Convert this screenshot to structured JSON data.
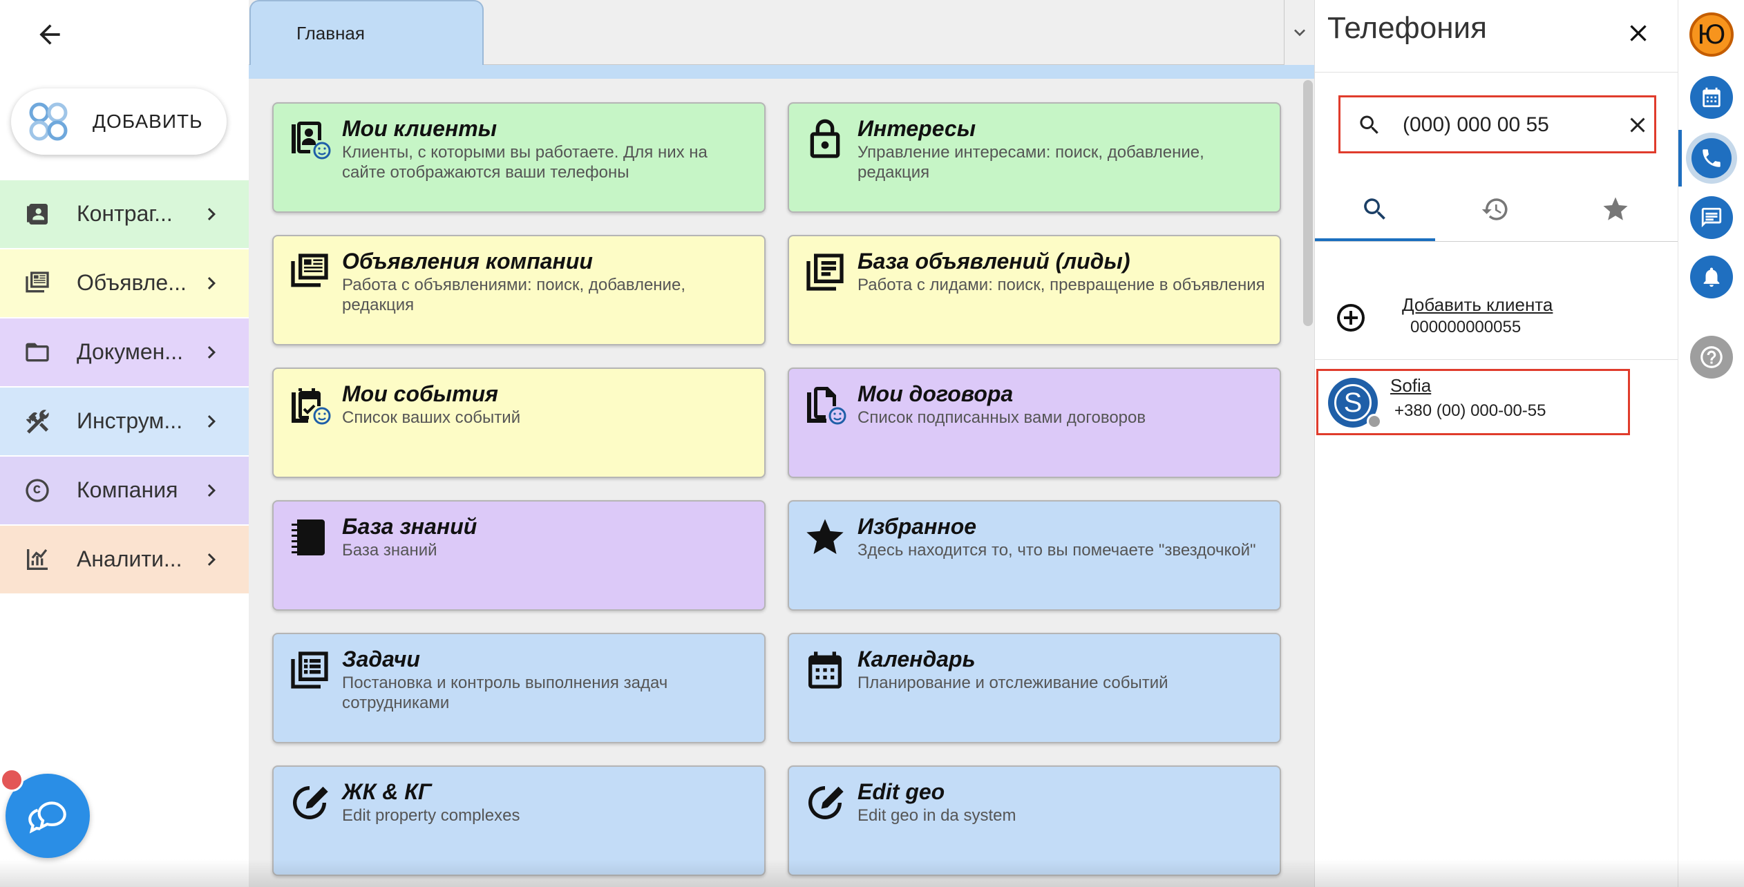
{
  "sidebar": {
    "add_label": "ДОБАВИТЬ",
    "items": [
      {
        "label": "Контраг...",
        "icon": "contacts-icon",
        "bg": "#d9f7d9"
      },
      {
        "label": "Объявле...",
        "icon": "listing-icon",
        "bg": "#fdfdd0"
      },
      {
        "label": "Докумен...",
        "icon": "folder-icon",
        "bg": "#e3d4fa"
      },
      {
        "label": "Инструм...",
        "icon": "tools-icon",
        "bg": "#d3e6fa"
      },
      {
        "label": "Компания",
        "icon": "copyright-icon",
        "bg": "#ddd3f8"
      },
      {
        "label": "Аналити...",
        "icon": "analytics-icon",
        "bg": "#fbe3d0"
      }
    ]
  },
  "tabs": {
    "home_label": "Главная"
  },
  "cards": [
    {
      "title": "Мои клиенты",
      "desc": "Клиенты, с которыми вы работаете. Для них на сайте отображаются ваши телефоны",
      "color": "green",
      "icon": "my-clients-icon"
    },
    {
      "title": "Интересы",
      "desc": "Управление интересами: поиск, добавление, редакция",
      "color": "green",
      "icon": "lock-icon"
    },
    {
      "title": "Объявления компании",
      "desc": "Работа с объявлениями: поиск, добавление, редакция",
      "color": "yellow",
      "icon": "listing-icon"
    },
    {
      "title": "База объявлений (лиды)",
      "desc": "Работа с лидами: поиск, превращение в объявления",
      "color": "yellow",
      "icon": "leads-icon"
    },
    {
      "title": "Мои события",
      "desc": "Список ваших событий",
      "color": "yellow",
      "icon": "my-events-icon"
    },
    {
      "title": "Мои договора",
      "desc": "Список подписанных вами договоров",
      "color": "purple",
      "icon": "contracts-icon"
    },
    {
      "title": "База знаний",
      "desc": "База знаний",
      "color": "purple",
      "icon": "knowledge-base-icon"
    },
    {
      "title": "Избранное",
      "desc": "Здесь находится то, что вы помечаете \"звездочкой\"",
      "color": "blue",
      "icon": "star-icon"
    },
    {
      "title": "Задачи",
      "desc": "Постановка и контроль выполнения задач сотрудниками",
      "color": "blue",
      "icon": "tasks-icon"
    },
    {
      "title": "Календарь",
      "desc": "Планирование и отслеживание событий",
      "color": "blue",
      "icon": "calendar-icon"
    },
    {
      "title": "ЖК & КГ",
      "desc": "Edit property complexes",
      "color": "blue",
      "icon": "edit-icon"
    },
    {
      "title": "Edit geo",
      "desc": "Edit geo in da system",
      "color": "blue",
      "icon": "edit-icon"
    }
  ],
  "telephony": {
    "title": "Телефония",
    "search_value": "(000) 000 00 55",
    "add_client_label": "Добавить клиента",
    "add_client_number": "000000000055",
    "contact_name": "Sofia",
    "contact_phone": "+380 (00) 000-00-55",
    "contact_initial": "S"
  },
  "rail": {
    "user_initial": "Ю"
  }
}
